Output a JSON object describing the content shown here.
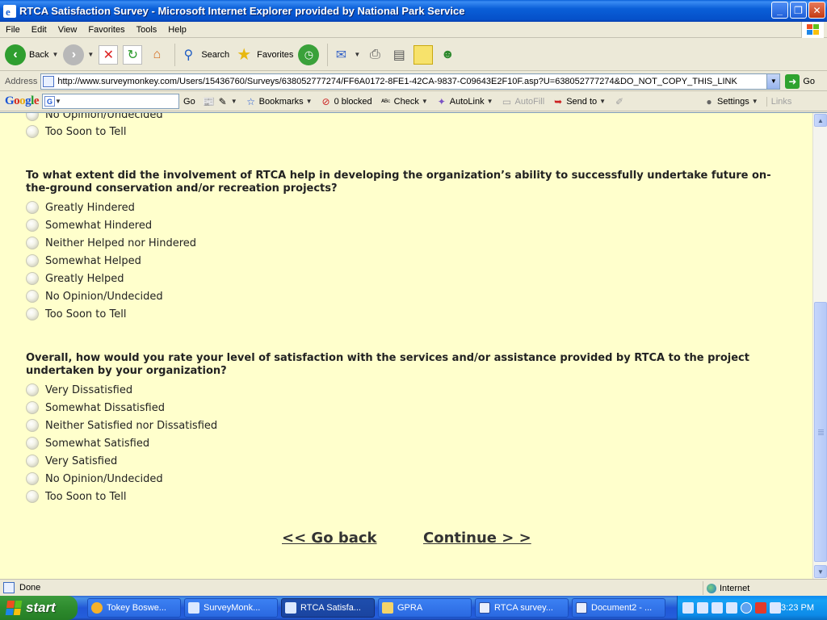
{
  "window": {
    "title": "RTCA Satisfaction Survey - Microsoft Internet Explorer provided by National Park Service",
    "minimize": "_",
    "maximize": "❐",
    "close": "✕"
  },
  "menu": [
    "File",
    "Edit",
    "View",
    "Favorites",
    "Tools",
    "Help"
  ],
  "toolbar": {
    "back": "Back",
    "search": "Search",
    "favorites": "Favorites",
    "icons": [
      "back-arrow-icon",
      "forward-arrow-icon",
      "stop-icon",
      "refresh-icon",
      "home-icon",
      "search-icon",
      "favorites-star-icon",
      "history-icon",
      "mail-icon",
      "print-icon",
      "edit-icon",
      "discuss-icon",
      "messenger-icon"
    ]
  },
  "address": {
    "label": "Address",
    "url": "http://www.surveymonkey.com/Users/15436760/Surveys/638052777274/FF6A0172-8FE1-42CA-9837-C09643E2F10F.asp?U=638052777274&DO_NOT_COPY_THIS_LINK",
    "go": "Go"
  },
  "google_toolbar": {
    "logo": "Google",
    "go": "Go",
    "bookmarks": "Bookmarks",
    "blocked": "0 blocked",
    "check": "Check",
    "autolink": "AutoLink",
    "autofill": "AutoFill",
    "sendto": "Send to",
    "settings": "Settings",
    "links": "Links"
  },
  "survey": {
    "prev_options": [
      "No Opinion/Undecided",
      "Too Soon to Tell"
    ],
    "questions": [
      {
        "text": "To what extent did the involvement of RTCA help in developing the organization’s ability to successfully undertake future on-the-ground conservation and/or recreation projects?",
        "options": [
          "Greatly Hindered",
          "Somewhat Hindered",
          "Neither Helped nor Hindered",
          "Somewhat Helped",
          "Greatly Helped",
          "No Opinion/Undecided",
          "Too Soon to Tell"
        ]
      },
      {
        "text": "Overall, how would you rate your level of satisfaction with the services and/or assistance provided by RTCA to the project undertaken by your organization?",
        "options": [
          "Very Dissatisfied",
          "Somewhat Dissatisfied",
          "Neither Satisfied nor Dissatisfied",
          "Somewhat Satisfied",
          "Very Satisfied",
          "No Opinion/Undecided",
          "Too Soon to Tell"
        ]
      }
    ],
    "go_back": "<< Go back",
    "continue": "Continue > >"
  },
  "status": {
    "text": "Done",
    "zone": "Internet"
  },
  "taskbar": {
    "start": "start",
    "tasks": [
      {
        "label": "Tokey Boswe...",
        "icon": "outlook-icon",
        "active": false
      },
      {
        "label": "SurveyMonk...",
        "icon": "ie-icon",
        "active": false
      },
      {
        "label": "RTCA Satisfa...",
        "icon": "ie-icon",
        "active": true
      },
      {
        "label": "GPRA",
        "icon": "folder-icon",
        "active": false
      },
      {
        "label": "RTCA survey...",
        "icon": "word-icon",
        "active": false
      },
      {
        "label": "Document2 - ...",
        "icon": "word-icon",
        "active": false
      }
    ],
    "time": "3:23 PM"
  }
}
